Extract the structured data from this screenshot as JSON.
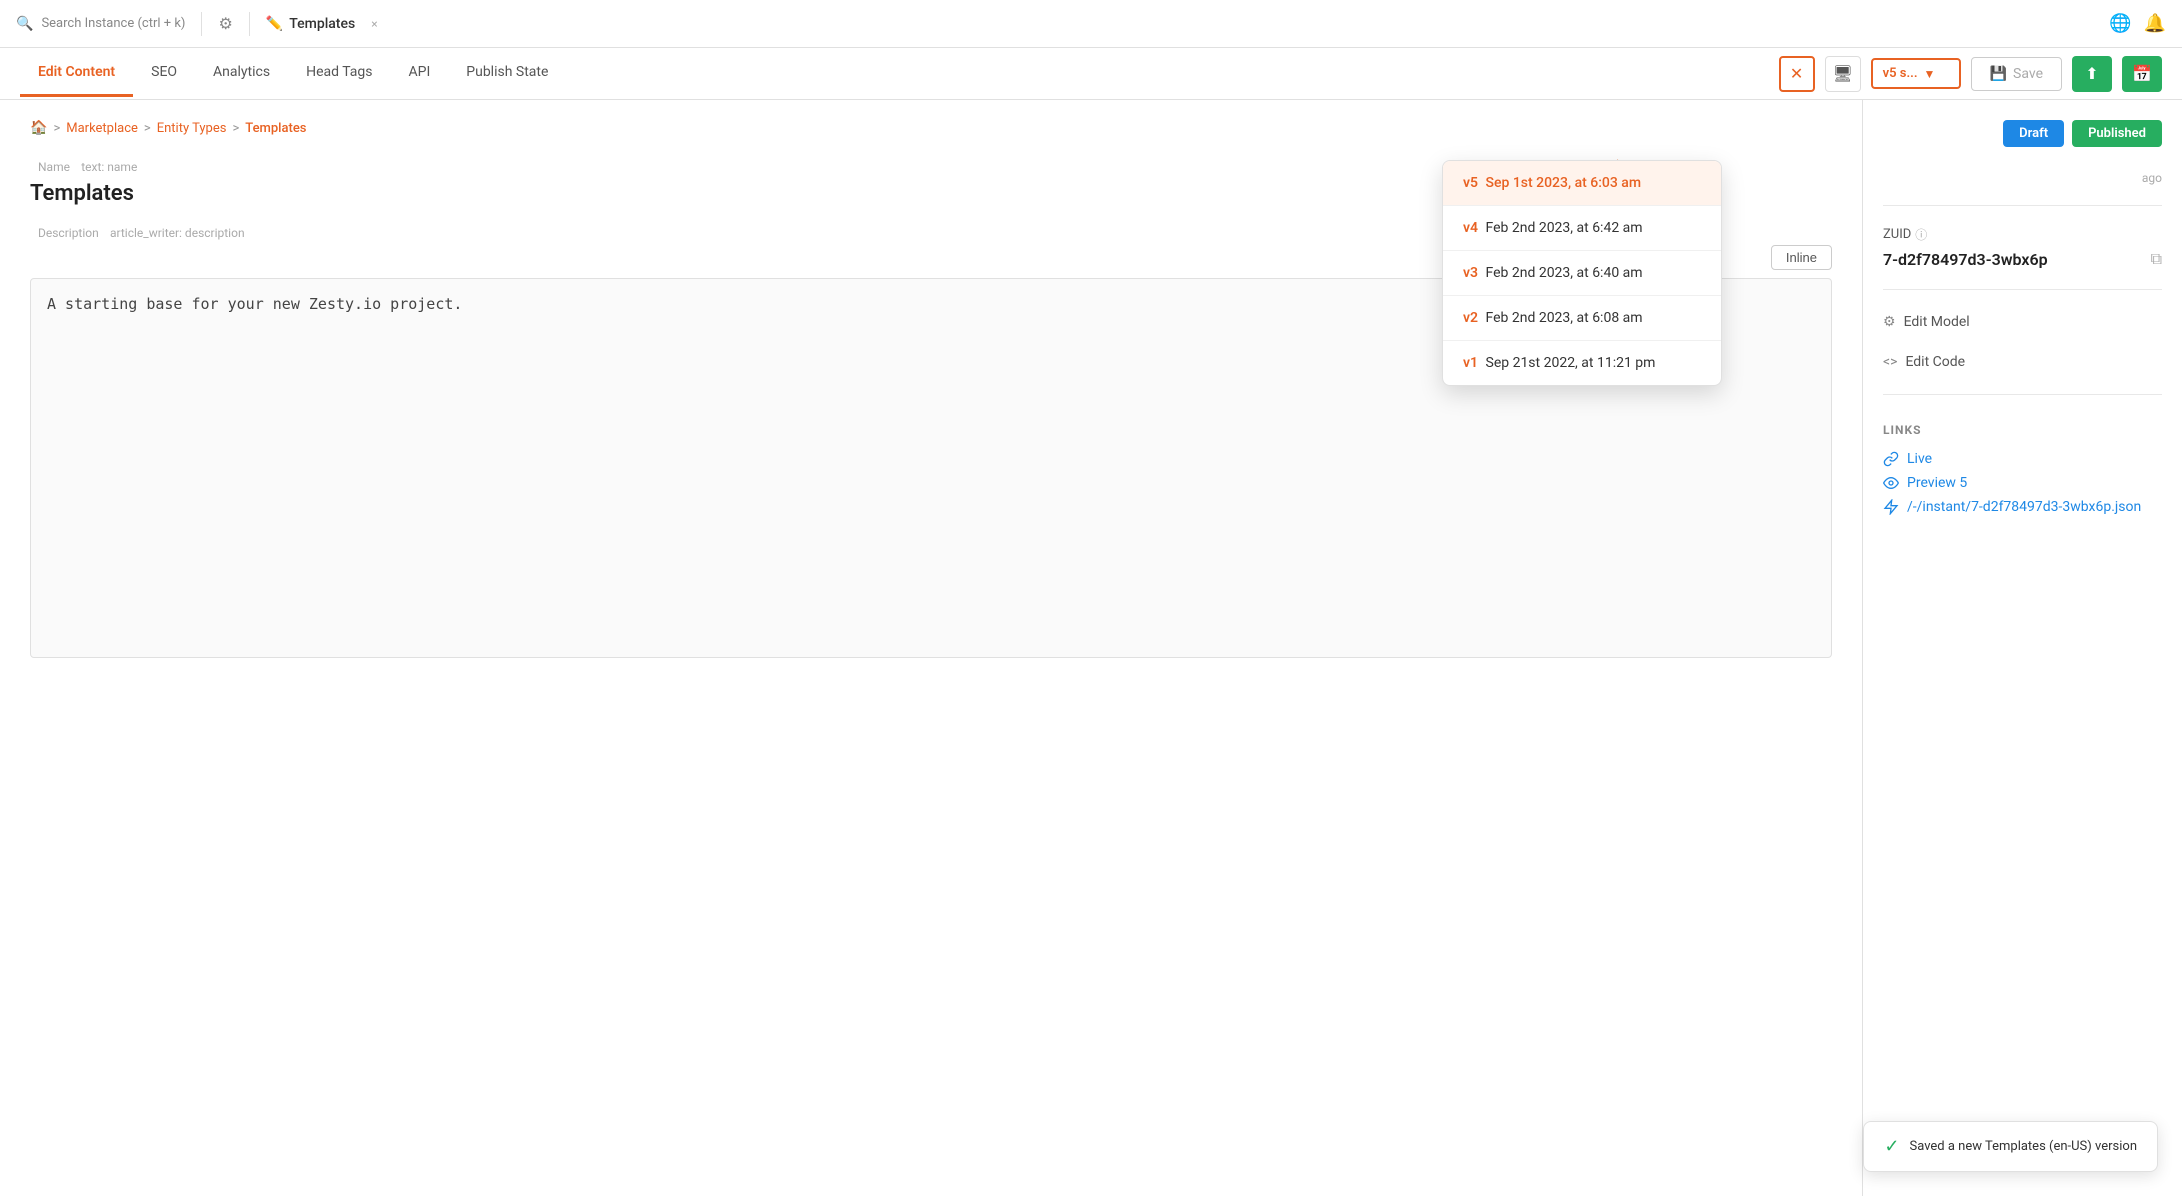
{
  "topbar": {
    "search_label": "Search Instance (ctrl + k)",
    "tab_label": "Templates",
    "close_icon": "×"
  },
  "tabs": {
    "items": [
      {
        "id": "edit-content",
        "label": "Edit Content",
        "active": true
      },
      {
        "id": "seo",
        "label": "SEO",
        "active": false
      },
      {
        "id": "analytics",
        "label": "Analytics",
        "active": false
      },
      {
        "id": "head-tags",
        "label": "Head Tags",
        "active": false
      },
      {
        "id": "api",
        "label": "API",
        "active": false
      },
      {
        "id": "publish-state",
        "label": "Publish State",
        "active": false
      }
    ],
    "save_label": "Save",
    "version_select_label": "v5 s..."
  },
  "breadcrumb": {
    "home_icon": "🏠",
    "items": [
      {
        "label": "Marketplace",
        "active": true
      },
      {
        "label": "Entity Types",
        "active": true
      },
      {
        "label": "Templates",
        "active": true
      }
    ]
  },
  "fields": {
    "name_label": "Name",
    "name_sublabel": "text: name",
    "name_value": "Templates",
    "description_label": "Description",
    "description_sublabel": "article_writer: description",
    "description_value": "A starting base for your new Zesty.io project.",
    "inline_btn": "Inline"
  },
  "version_dropdown": {
    "items": [
      {
        "v": "v5",
        "date": "Sep 1st 2023, at 6:03 am",
        "selected": true
      },
      {
        "v": "v4",
        "date": "Feb 2nd 2023, at 6:42 am",
        "selected": false
      },
      {
        "v": "v3",
        "date": "Feb 2nd 2023, at 6:40 am",
        "selected": false
      },
      {
        "v": "v2",
        "date": "Feb 2nd 2023, at 6:08 am",
        "selected": false
      },
      {
        "v": "v1",
        "date": "Sep 21st 2022, at 11:21 pm",
        "selected": false
      }
    ]
  },
  "sidebar": {
    "draft_label": "Draft",
    "published_label": "Published",
    "ago_text": "ago",
    "zuidfield": {
      "label": "ZUID",
      "value": "7-d2f78497d3-3wbx6p"
    },
    "edit_model_label": "Edit Model",
    "edit_code_label": "Edit Code",
    "links_title": "LINKS",
    "links": [
      {
        "id": "live",
        "label": "Live",
        "icon": "link"
      },
      {
        "id": "preview5",
        "label": "Preview 5",
        "icon": "eye"
      },
      {
        "id": "instant",
        "label": "/-/instant/7-d2f78497d3-3wbx6p.json",
        "icon": "bolt"
      }
    ]
  },
  "toast": {
    "message": "Saved a new Templates (en-US) version",
    "check_icon": "✓"
  },
  "colors": {
    "orange": "#e86223",
    "blue": "#1e88e5",
    "green": "#27ae60"
  }
}
